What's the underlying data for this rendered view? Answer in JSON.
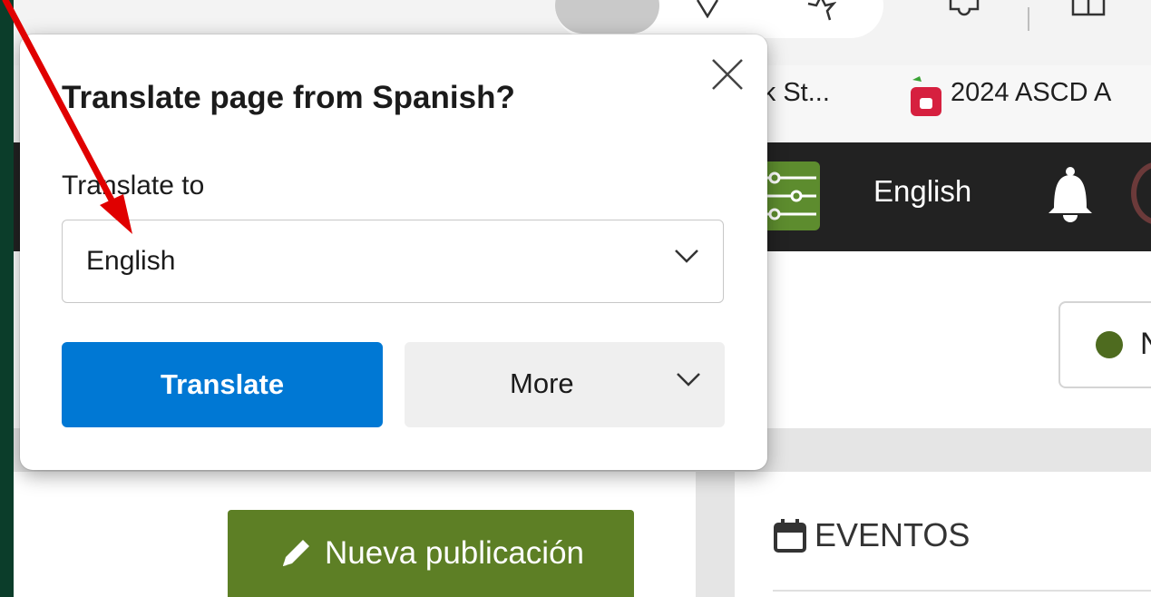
{
  "bookmarks": {
    "item1_label": "ork St...",
    "item2_label": "2024 ASCD A"
  },
  "site_header": {
    "language_label": "English"
  },
  "status_chip": {
    "partial_text": "N"
  },
  "page": {
    "new_post_label": "Nueva publicación",
    "events_label": "EVENTOS"
  },
  "translate_popup": {
    "title": "Translate page from Spanish?",
    "translate_to_label": "Translate to",
    "selected_language": "English",
    "translate_button_label": "Translate",
    "more_button_label": "More"
  },
  "colors": {
    "translate_button": "#0078d4",
    "site_accent_green": "#5d7f25",
    "annotation_arrow": "#e00000",
    "background_frame": "#0b3d2a"
  },
  "icons": [
    "close-icon",
    "chevron-down-icon",
    "bell-icon",
    "filter-sliders-icon",
    "pencil-icon",
    "calendar-icon",
    "star-icon",
    "puzzle-icon",
    "split-screen-icon"
  ]
}
